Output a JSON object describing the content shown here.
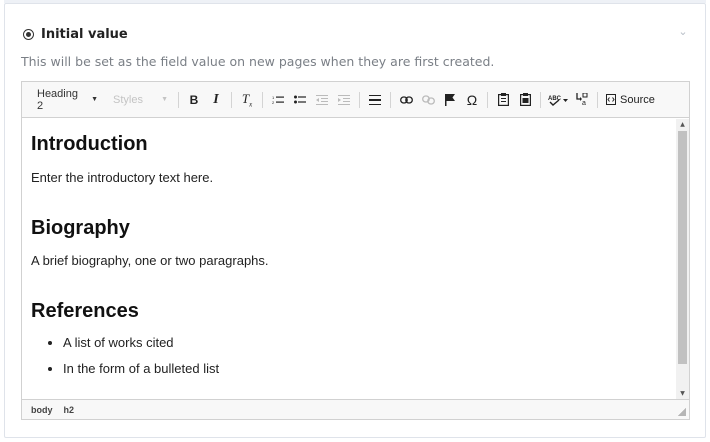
{
  "field": {
    "title": "Initial value",
    "help_text": "This will be set as the field value on new pages when they are first created."
  },
  "toolbar": {
    "heading_select": "Heading 2",
    "styles_select": "Styles",
    "buttons": [
      {
        "icon": "bold-icon",
        "glyph": "B"
      },
      {
        "icon": "italic-icon",
        "glyph": "I"
      },
      {
        "icon": "remove-format-icon",
        "glyph": "Tx"
      },
      {
        "icon": "numbered-list-icon",
        "glyph": "⒈"
      },
      {
        "icon": "bulleted-list-icon",
        "glyph": "•"
      },
      {
        "icon": "outdent-icon",
        "glyph": "⇤"
      },
      {
        "icon": "indent-icon",
        "glyph": "⇥"
      },
      {
        "icon": "horizontal-rule-icon",
        "glyph": "≡"
      },
      {
        "icon": "link-icon",
        "glyph": "∞"
      },
      {
        "icon": "unlink-icon",
        "glyph": "⊘"
      },
      {
        "icon": "anchor-flag-icon",
        "glyph": "⚑"
      },
      {
        "icon": "special-character-icon",
        "glyph": "Ω"
      },
      {
        "icon": "paste-icon",
        "glyph": "📋"
      },
      {
        "icon": "paste-text-icon",
        "glyph": "📄"
      },
      {
        "icon": "spellcheck-icon",
        "glyph": "ᴬᴮᶜ"
      },
      {
        "icon": "find-replace-icon",
        "glyph": "⇄"
      }
    ],
    "source_label": "Source"
  },
  "content": {
    "h_intro": "Introduction",
    "p_intro": "Enter the introductory text here.",
    "h_bio": "Biography",
    "p_bio": "A brief biography, one or two paragraphs.",
    "h_ref": "References",
    "ref_items": [
      "A list of works cited",
      "In the form of a bulleted list"
    ]
  },
  "statusbar": {
    "path": [
      "body",
      "h2"
    ]
  }
}
